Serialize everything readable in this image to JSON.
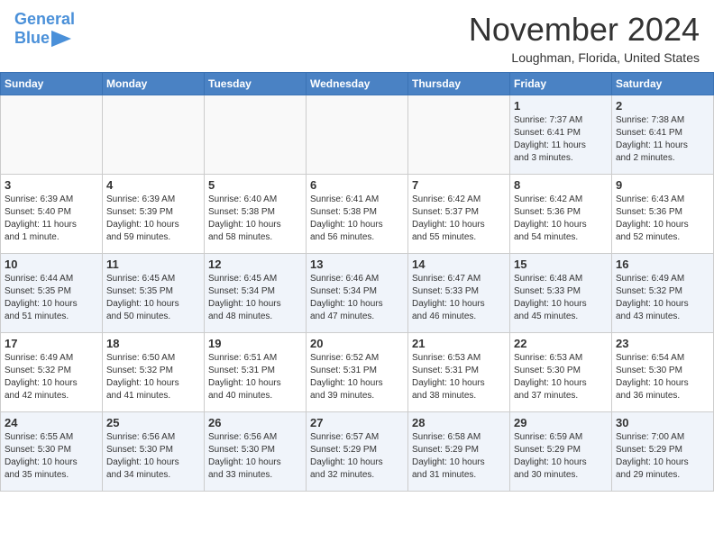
{
  "header": {
    "logo_line1": "General",
    "logo_line2": "Blue",
    "month": "November 2024",
    "location": "Loughman, Florida, United States"
  },
  "weekdays": [
    "Sunday",
    "Monday",
    "Tuesday",
    "Wednesday",
    "Thursday",
    "Friday",
    "Saturday"
  ],
  "weeks": [
    [
      {
        "day": "",
        "info": ""
      },
      {
        "day": "",
        "info": ""
      },
      {
        "day": "",
        "info": ""
      },
      {
        "day": "",
        "info": ""
      },
      {
        "day": "",
        "info": ""
      },
      {
        "day": "1",
        "info": "Sunrise: 7:37 AM\nSunset: 6:41 PM\nDaylight: 11 hours\nand 3 minutes."
      },
      {
        "day": "2",
        "info": "Sunrise: 7:38 AM\nSunset: 6:41 PM\nDaylight: 11 hours\nand 2 minutes."
      }
    ],
    [
      {
        "day": "3",
        "info": "Sunrise: 6:39 AM\nSunset: 5:40 PM\nDaylight: 11 hours\nand 1 minute."
      },
      {
        "day": "4",
        "info": "Sunrise: 6:39 AM\nSunset: 5:39 PM\nDaylight: 10 hours\nand 59 minutes."
      },
      {
        "day": "5",
        "info": "Sunrise: 6:40 AM\nSunset: 5:38 PM\nDaylight: 10 hours\nand 58 minutes."
      },
      {
        "day": "6",
        "info": "Sunrise: 6:41 AM\nSunset: 5:38 PM\nDaylight: 10 hours\nand 56 minutes."
      },
      {
        "day": "7",
        "info": "Sunrise: 6:42 AM\nSunset: 5:37 PM\nDaylight: 10 hours\nand 55 minutes."
      },
      {
        "day": "8",
        "info": "Sunrise: 6:42 AM\nSunset: 5:36 PM\nDaylight: 10 hours\nand 54 minutes."
      },
      {
        "day": "9",
        "info": "Sunrise: 6:43 AM\nSunset: 5:36 PM\nDaylight: 10 hours\nand 52 minutes."
      }
    ],
    [
      {
        "day": "10",
        "info": "Sunrise: 6:44 AM\nSunset: 5:35 PM\nDaylight: 10 hours\nand 51 minutes."
      },
      {
        "day": "11",
        "info": "Sunrise: 6:45 AM\nSunset: 5:35 PM\nDaylight: 10 hours\nand 50 minutes."
      },
      {
        "day": "12",
        "info": "Sunrise: 6:45 AM\nSunset: 5:34 PM\nDaylight: 10 hours\nand 48 minutes."
      },
      {
        "day": "13",
        "info": "Sunrise: 6:46 AM\nSunset: 5:34 PM\nDaylight: 10 hours\nand 47 minutes."
      },
      {
        "day": "14",
        "info": "Sunrise: 6:47 AM\nSunset: 5:33 PM\nDaylight: 10 hours\nand 46 minutes."
      },
      {
        "day": "15",
        "info": "Sunrise: 6:48 AM\nSunset: 5:33 PM\nDaylight: 10 hours\nand 45 minutes."
      },
      {
        "day": "16",
        "info": "Sunrise: 6:49 AM\nSunset: 5:32 PM\nDaylight: 10 hours\nand 43 minutes."
      }
    ],
    [
      {
        "day": "17",
        "info": "Sunrise: 6:49 AM\nSunset: 5:32 PM\nDaylight: 10 hours\nand 42 minutes."
      },
      {
        "day": "18",
        "info": "Sunrise: 6:50 AM\nSunset: 5:32 PM\nDaylight: 10 hours\nand 41 minutes."
      },
      {
        "day": "19",
        "info": "Sunrise: 6:51 AM\nSunset: 5:31 PM\nDaylight: 10 hours\nand 40 minutes."
      },
      {
        "day": "20",
        "info": "Sunrise: 6:52 AM\nSunset: 5:31 PM\nDaylight: 10 hours\nand 39 minutes."
      },
      {
        "day": "21",
        "info": "Sunrise: 6:53 AM\nSunset: 5:31 PM\nDaylight: 10 hours\nand 38 minutes."
      },
      {
        "day": "22",
        "info": "Sunrise: 6:53 AM\nSunset: 5:30 PM\nDaylight: 10 hours\nand 37 minutes."
      },
      {
        "day": "23",
        "info": "Sunrise: 6:54 AM\nSunset: 5:30 PM\nDaylight: 10 hours\nand 36 minutes."
      }
    ],
    [
      {
        "day": "24",
        "info": "Sunrise: 6:55 AM\nSunset: 5:30 PM\nDaylight: 10 hours\nand 35 minutes."
      },
      {
        "day": "25",
        "info": "Sunrise: 6:56 AM\nSunset: 5:30 PM\nDaylight: 10 hours\nand 34 minutes."
      },
      {
        "day": "26",
        "info": "Sunrise: 6:56 AM\nSunset: 5:30 PM\nDaylight: 10 hours\nand 33 minutes."
      },
      {
        "day": "27",
        "info": "Sunrise: 6:57 AM\nSunset: 5:29 PM\nDaylight: 10 hours\nand 32 minutes."
      },
      {
        "day": "28",
        "info": "Sunrise: 6:58 AM\nSunset: 5:29 PM\nDaylight: 10 hours\nand 31 minutes."
      },
      {
        "day": "29",
        "info": "Sunrise: 6:59 AM\nSunset: 5:29 PM\nDaylight: 10 hours\nand 30 minutes."
      },
      {
        "day": "30",
        "info": "Sunrise: 7:00 AM\nSunset: 5:29 PM\nDaylight: 10 hours\nand 29 minutes."
      }
    ]
  ]
}
